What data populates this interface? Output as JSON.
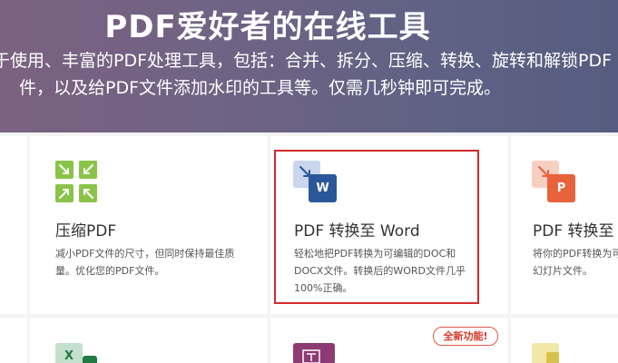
{
  "hero": {
    "title": "PDF爱好者的在线工具",
    "line1": "于使用、丰富的PDF处理工具，包括：合并、拆分、压缩、转换、旋转和解锁PDF",
    "line2": "件，以及给PDF文件添加水印的工具等。仅需几秒钟即可完成。"
  },
  "tools": [
    {
      "title": "压缩PDF",
      "desc1": "减小PDF文件的尺寸，但同时保持最佳质",
      "desc2": "量。优化您的PDF文件。",
      "icon": "compress-icon",
      "color": "#8bc34a"
    },
    {
      "title": "PDF 转换至 Word",
      "desc1": "轻松地把PDF转换为可编辑的DOC和",
      "desc2": "DOCX文件。转换后的WORD文件几乎",
      "desc3": "100%正确。",
      "icon": "word-icon",
      "icon_letter": "W",
      "color": "#2b579a"
    },
    {
      "title": "PDF 转换至",
      "desc1": "将你的PDF转换为可",
      "desc2": "幻灯片文件。",
      "icon": "powerpoint-icon",
      "icon_letter": "P",
      "color": "#e8623c"
    },
    {
      "icon": "excel-icon",
      "icon_letter": "X",
      "color": "#1f7a43"
    },
    {
      "icon": "edit-pdf-icon",
      "color": "#8e3a73",
      "badge": "全新功能!"
    },
    {
      "icon": "jpg-icon",
      "color": "#d9c24a"
    }
  ]
}
